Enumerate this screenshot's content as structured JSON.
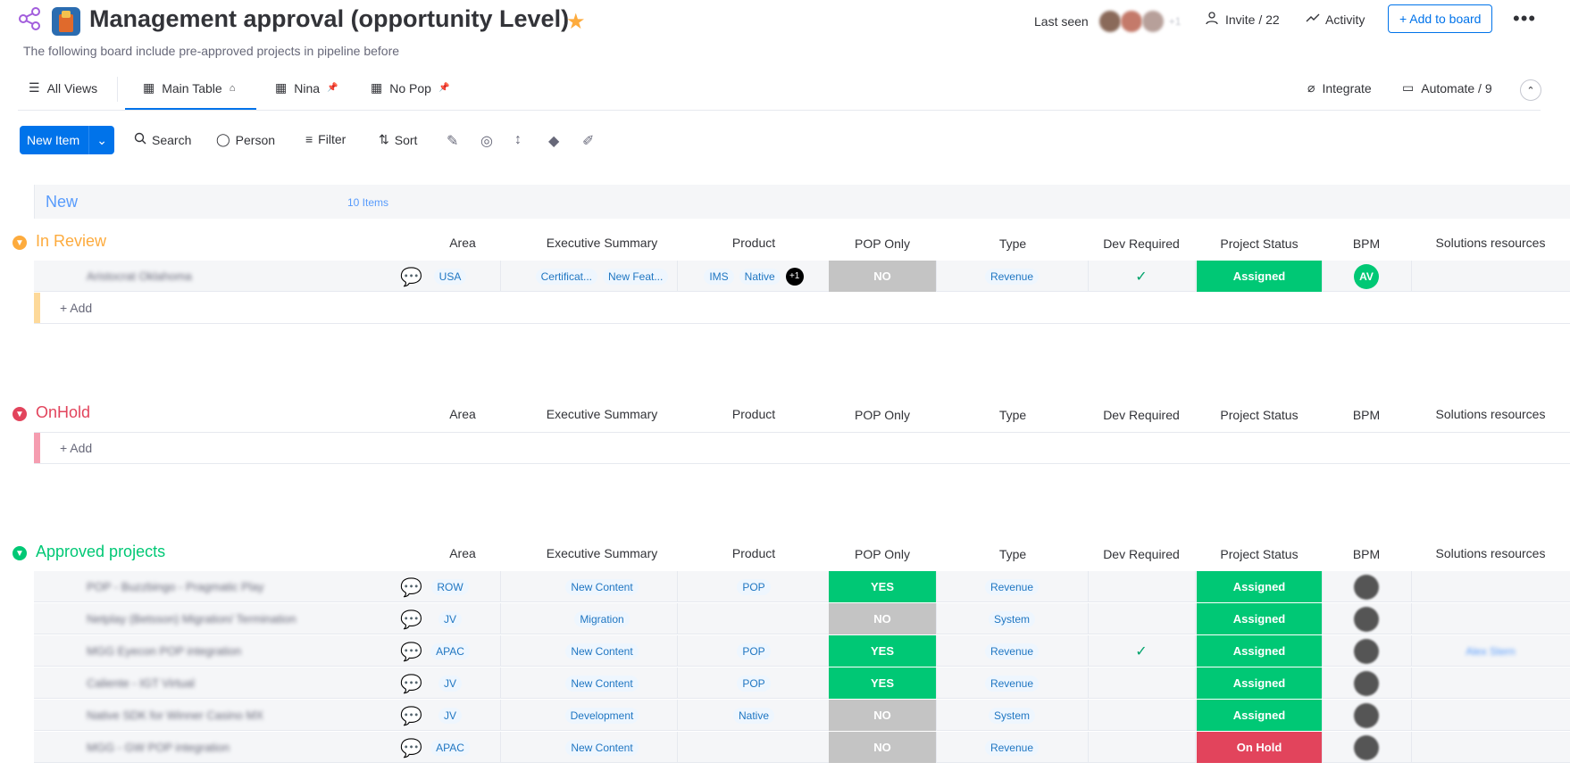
{
  "header": {
    "title": "Management approval (opportunity Level)",
    "subtitle": "The following board include pre-approved projects in pipeline before",
    "last_seen_label": "Last seen",
    "last_seen_more": "+1",
    "invite_label": "Invite / 22",
    "activity_label": "Activity",
    "add_to_board_label": "+ Add to board"
  },
  "tabs": {
    "all_views": "All Views",
    "main_table": "Main Table",
    "nina": "Nina",
    "no_pop": "No Pop",
    "integrate": "Integrate",
    "automate": "Automate / 9"
  },
  "toolbar": {
    "new_item": "New Item",
    "search": "Search",
    "person": "Person",
    "filter": "Filter",
    "sort": "Sort"
  },
  "columns": [
    "Area",
    "Executive Summary",
    "Product",
    "POP Only",
    "Type",
    "Dev Required",
    "Project Status",
    "BPM",
    "Solutions resources"
  ],
  "groups": {
    "new": {
      "title": "New",
      "count": "10 Items",
      "color": "#579bfc"
    },
    "in_review": {
      "title": "In Review",
      "color": "#fdab3d",
      "add_label": "+ Add",
      "rows": [
        {
          "name": "Aristocrat Oklahoma",
          "area": "USA",
          "summary": [
            "Certificat...",
            "New Feat..."
          ],
          "product": [
            "IMS",
            "Native"
          ],
          "product_more": "+1",
          "pop": "NO",
          "type": "Revenue",
          "dev": "✓",
          "status": "Assigned",
          "bpm": "AV",
          "solutions": ""
        }
      ]
    },
    "on_hold": {
      "title": "OnHold",
      "color": "#e2445c",
      "add_label": "+ Add"
    },
    "approved": {
      "title": "Approved projects",
      "color": "#00c875",
      "rows": [
        {
          "name": "POP - Buzzbingo - Pragmatic Play",
          "area": "ROW",
          "summary": "New Content",
          "product": "POP",
          "pop": "YES",
          "type": "Revenue",
          "dev": "",
          "status": "Assigned",
          "solutions": ""
        },
        {
          "name": "Netplay (Betsson) Migration/ Termination",
          "area": "JV",
          "summary": "Migration",
          "product": "",
          "pop": "NO",
          "type": "System",
          "dev": "",
          "status": "Assigned",
          "solutions": ""
        },
        {
          "name": "MGG Eyecon POP integration",
          "area": "APAC",
          "summary": "New Content",
          "product": "POP",
          "pop": "YES",
          "type": "Revenue",
          "dev": "✓",
          "status": "Assigned",
          "solutions": "Alex Stern"
        },
        {
          "name": "Caliente - IGT Virtual",
          "area": "JV",
          "summary": "New Content",
          "product": "POP",
          "pop": "YES",
          "type": "Revenue",
          "dev": "",
          "status": "Assigned",
          "solutions": ""
        },
        {
          "name": "Native SDK for Winner Casino MX",
          "area": "JV",
          "summary": "Development",
          "product": "Native",
          "pop": "NO",
          "type": "System",
          "dev": "",
          "status": "Assigned",
          "solutions": ""
        },
        {
          "name": "MGG - GW POP integration",
          "area": "APAC",
          "summary": "New Content",
          "product": "",
          "pop": "NO",
          "type": "Revenue",
          "dev": "",
          "status": "On Hold",
          "solutions": ""
        }
      ]
    }
  },
  "colors": {
    "status_assigned": "#00c875",
    "status_on_hold": "#e2445c",
    "pop_yes": "#00c875",
    "pop_no": "#c4c4c4",
    "accent": "#0073ea"
  }
}
